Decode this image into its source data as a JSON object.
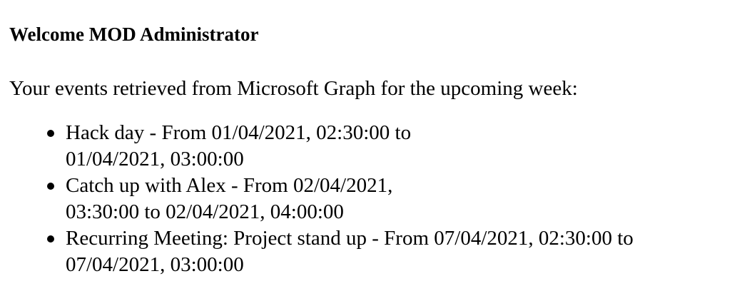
{
  "greeting": {
    "text": "Welcome MOD Administrator"
  },
  "intro": {
    "text": "Your events retrieved from Microsoft Graph for the upcoming week:"
  },
  "events": [
    {
      "text": "Hack day - From 01/04/2021, 02:30:00 to 01/04/2021, 03:00:00"
    },
    {
      "text": "Catch up with Alex - From 02/04/2021, 03:30:00 to 02/04/2021, 04:00:00"
    },
    {
      "text": "Recurring Meeting: Project stand up - From 07/04/2021, 02:30:00 to 07/04/2021, 03:00:00"
    }
  ]
}
